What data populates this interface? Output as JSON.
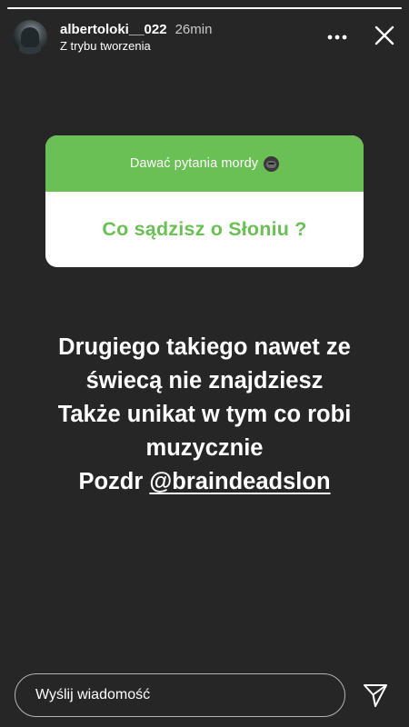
{
  "story": {
    "progress_fraction": 1.0,
    "username": "albertoloki__022",
    "time_ago": "26min",
    "subtitle": "Z trybu tworzenia",
    "more_icon": "more-horizontal-icon",
    "close_icon": "close-icon"
  },
  "question_sticker": {
    "prompt": "Dawać pytania mordy",
    "prompt_icon": "gorilla-icon",
    "answer": "Co sądzisz o Słoniu ?",
    "accent_color": "#6abf55"
  },
  "message": {
    "lines": [
      "Drugiego takiego nawet ze",
      "świecą nie znajdziesz",
      "Także unikat w tym co robi",
      "muzycznie"
    ],
    "last_line_prefix": "Pozdr ",
    "mention": "@braindeadslon"
  },
  "reply": {
    "placeholder": "Wyślij wiadomość",
    "send_icon": "send-icon"
  },
  "colors": {
    "background": "#262626",
    "text": "#ffffff"
  }
}
